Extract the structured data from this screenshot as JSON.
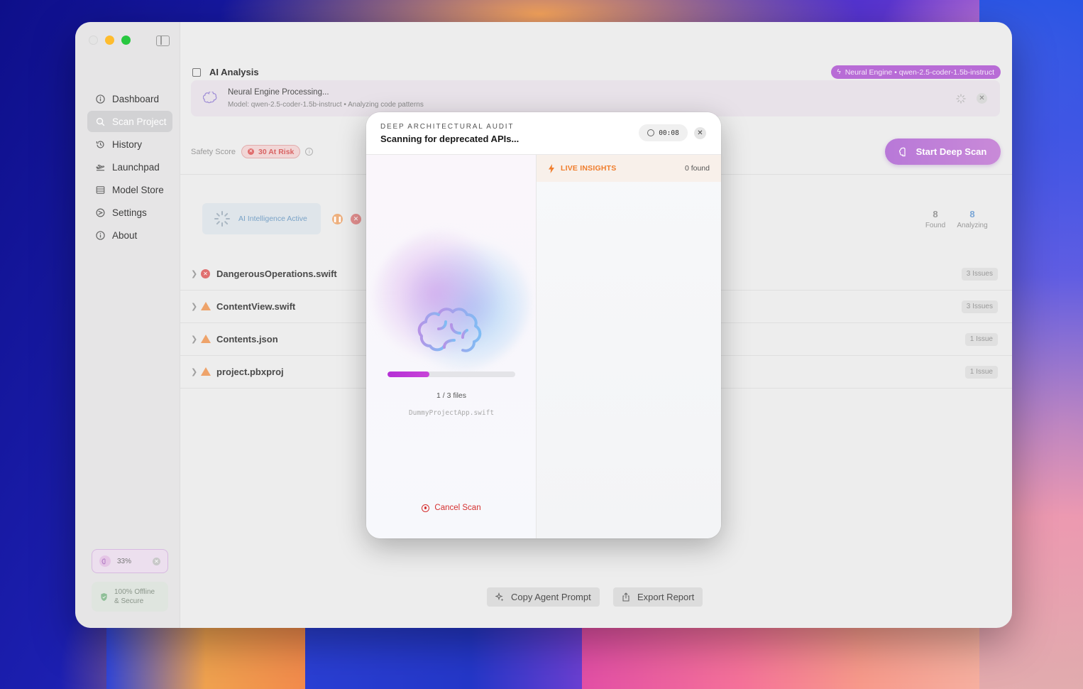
{
  "window": {
    "traffic_lights": [
      "close",
      "minimize",
      "maximize"
    ]
  },
  "sidebar": {
    "items": [
      {
        "label": "Dashboard",
        "icon": "info-circle-icon",
        "active": false
      },
      {
        "label": "Scan Project",
        "icon": "magnifier-icon",
        "active": true
      },
      {
        "label": "History",
        "icon": "history-icon",
        "active": false
      },
      {
        "label": "Launchpad",
        "icon": "airplane-icon",
        "active": false
      },
      {
        "label": "Model Store",
        "icon": "server-icon",
        "active": false
      },
      {
        "label": "Settings",
        "icon": "gear-icon",
        "active": false
      },
      {
        "label": "About",
        "icon": "info-circle-icon",
        "active": false
      }
    ],
    "progress_label": "33%",
    "offline_label_line1": "100% Offline",
    "offline_label_line2": "& Secure"
  },
  "main": {
    "section_title": "AI Analysis",
    "engine_badge": "Neural Engine • qwen-2.5-coder-1.5b-instruct",
    "processing": {
      "title": "Neural Engine Processing...",
      "subtitle": "Model: qwen-2.5-coder-1.5b-instruct • Analyzing code patterns"
    },
    "safety_label": "Safety Score",
    "risk_badge": "30 At Risk",
    "deep_scan_label": "Start Deep Scan",
    "ai_active_label": "AI Intelligence Active",
    "stats": {
      "found_value": "8",
      "found_label": "Found",
      "analyzing_value": "8",
      "analyzing_label": "Analyzing"
    },
    "files": [
      {
        "name": "DangerousOperations.swift",
        "severity": "error",
        "issues": "3 Issues"
      },
      {
        "name": "ContentView.swift",
        "severity": "warning",
        "issues": "3 Issues"
      },
      {
        "name": "Contents.json",
        "severity": "warning",
        "issues": "1 Issue"
      },
      {
        "name": "project.pbxproj",
        "severity": "warning",
        "issues": "1 Issue"
      }
    ],
    "footer": {
      "copy_prompt_label": "Copy Agent Prompt",
      "export_label": "Export Report"
    }
  },
  "modal": {
    "kicker": "DEEP ARCHITECTURAL AUDIT",
    "title": "Scanning for deprecated APIs...",
    "timer": "00:08",
    "progress_fraction": 0.33,
    "progress_text": "1 / 3 files",
    "current_file": "DummyProjectApp.swift",
    "cancel_label": "Cancel Scan",
    "insights_label": "LIVE INSIGHTS",
    "insights_count": "0 found"
  },
  "colors": {
    "accent_purple": "#b86cd6",
    "progress_magenta": "#c035d8",
    "insights_orange": "#f07d2c",
    "cancel_red": "#d53030",
    "risk_red": "#d86464"
  }
}
